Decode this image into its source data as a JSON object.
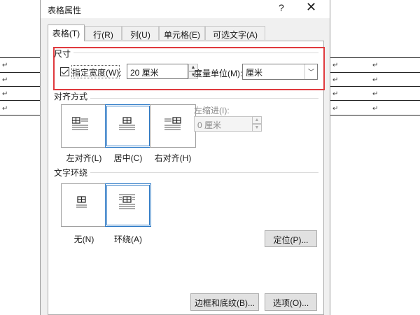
{
  "dialog": {
    "title": "表格属性",
    "help_label": "?",
    "close_label": "✕"
  },
  "tabs": [
    {
      "label": "表格(T)",
      "active": true
    },
    {
      "label": "行(R)"
    },
    {
      "label": "列(U)"
    },
    {
      "label": "单元格(E)"
    },
    {
      "label": "可选文字(A)"
    }
  ],
  "size": {
    "section_label": "尺寸",
    "preferred_width_label": "指定宽度(W):",
    "preferred_width_checked": true,
    "width_value": "20 厘米",
    "measure_label": "度量单位(M):",
    "measure_value": "厘米"
  },
  "alignment": {
    "section_label": "对齐方式",
    "options": [
      {
        "label": "左对齐(L)"
      },
      {
        "label": "居中(C)",
        "selected": true
      },
      {
        "label": "右对齐(H)"
      }
    ],
    "indent_label": "左缩进(I):",
    "indent_value": "0 厘米"
  },
  "wrapping": {
    "section_label": "文字环绕",
    "options": [
      {
        "label": "无(N)"
      },
      {
        "label": "环绕(A)",
        "selected": true
      }
    ],
    "position_button": "定位(P)..."
  },
  "footer": {
    "borders_button": "边框和底纹(B)...",
    "options_button": "选项(O)..."
  },
  "document": {
    "cell_mark": "↵"
  },
  "colors": {
    "highlight": "#e03a3e",
    "selection": "#2b78c5"
  }
}
